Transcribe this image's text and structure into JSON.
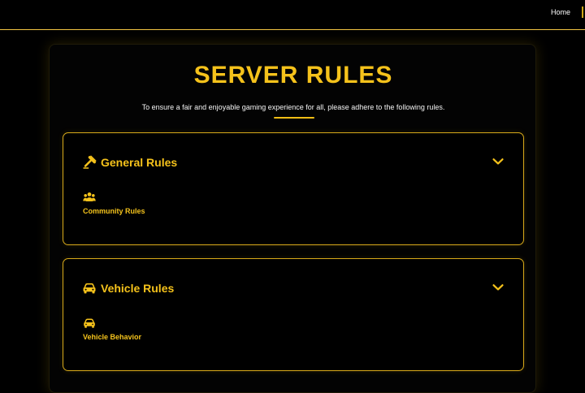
{
  "nav": {
    "home_label": "Home"
  },
  "page": {
    "title": "SERVER RULES",
    "subtitle": "To ensure a fair and enjoyable gaming experience for all, please adhere to the following rules.",
    "accent_color": "#f5c21b",
    "background_color": "#000000"
  },
  "sections": [
    {
      "title": "General Rules",
      "icon": "gavel-icon",
      "expanded": true,
      "items": [
        {
          "label": "Community Rules",
          "icon": "community-icon"
        }
      ]
    },
    {
      "title": "Vehicle Rules",
      "icon": "car-icon",
      "expanded": true,
      "items": [
        {
          "label": "Vehicle Behavior",
          "icon": "car-icon"
        }
      ]
    }
  ]
}
